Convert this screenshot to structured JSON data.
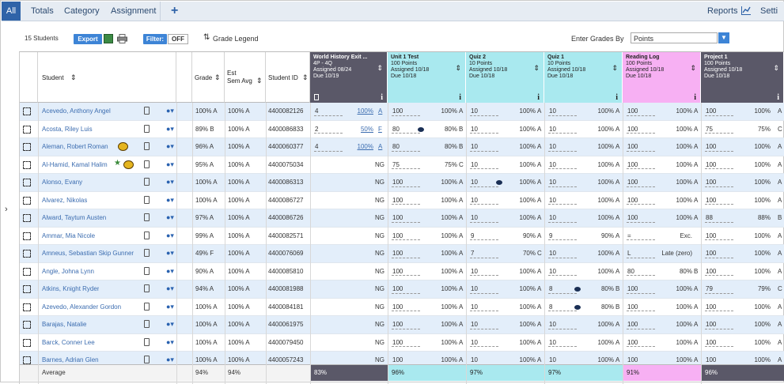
{
  "topbar": {
    "tabs": [
      "All",
      "Totals",
      "Category",
      "Assignment"
    ],
    "add_icon": "+",
    "reports_label": "Reports",
    "settings_label": "Setti"
  },
  "toolbar": {
    "student_count": "15 Students",
    "export_label": "Export",
    "filter_label": "Filter:",
    "filter_state": "OFF",
    "grade_legend": "Grade Legend",
    "enter_grades_label": "Enter Grades By",
    "enter_grades_value": "Points"
  },
  "columns": {
    "student": "Student",
    "grade": "Grade",
    "est_sem_avg_1": "Est",
    "est_sem_avg_2": "Sem Avg",
    "student_id": "Student ID"
  },
  "assignments": [
    {
      "title": "World History Exit ...",
      "l2": "4P - 4Q",
      "l3": "Assigned 08/24",
      "l4": "Due 10/19",
      "color": "#5a5868",
      "text": "#fff"
    },
    {
      "title": "Unit 1 Test",
      "l2": "100 Points",
      "l3": "Assigned 10/18",
      "l4": "Due 10/18",
      "color": "#a9e9ef",
      "text": "#222"
    },
    {
      "title": "Quiz 2",
      "l2": "10 Points",
      "l3": "Assigned 10/18",
      "l4": "Due 10/18",
      "color": "#a9e9ef",
      "text": "#222"
    },
    {
      "title": "Quiz 1",
      "l2": "10 Points",
      "l3": "Assigned 10/18",
      "l4": "Due 10/18",
      "color": "#a9e9ef",
      "text": "#222"
    },
    {
      "title": "Reading Log",
      "l2": "100 Points",
      "l3": "Assigned 10/18",
      "l4": "Due 10/18",
      "color": "#f7b0f3",
      "text": "#222"
    },
    {
      "title": "Project 1",
      "l2": "100 Points",
      "l3": "Assigned 10/18",
      "l4": "Due 10/18",
      "color": "#5a5868",
      "text": "#fff"
    }
  ],
  "students": [
    {
      "name": "Acevedo, Anthony Angel",
      "grade": "100% A",
      "est": "100% A",
      "id": "4400082126",
      "a1": [
        "4",
        "100%",
        "A"
      ],
      "a2": [
        "100",
        "100%",
        "A"
      ],
      "a3": [
        "10",
        "100%",
        "A"
      ],
      "a4": [
        "10",
        "100%",
        "A"
      ],
      "a5": [
        "100",
        "100%",
        "A"
      ],
      "a6": [
        "100",
        "100%",
        "A"
      ]
    },
    {
      "name": "Acosta, Riley Luis",
      "grade": "89% B",
      "est": "100% A",
      "id": "4400086833",
      "a1": [
        "2",
        "50%",
        "F"
      ],
      "a2": [
        "80",
        "80%",
        "B"
      ],
      "a3": [
        "10",
        "100%",
        "A"
      ],
      "a4": [
        "10",
        "100%",
        "A"
      ],
      "a5": [
        "100",
        "100%",
        "A"
      ],
      "a6": [
        "75",
        "75%",
        "C"
      ]
    },
    {
      "name": "Aleman, Robert Roman",
      "grade": "96% A",
      "est": "100% A",
      "id": "4400060377",
      "a1": [
        "4",
        "100%",
        "A"
      ],
      "a2": [
        "80",
        "80%",
        "B"
      ],
      "a3": [
        "10",
        "100%",
        "A"
      ],
      "a4": [
        "10",
        "100%",
        "A"
      ],
      "a5": [
        "100",
        "100%",
        "A"
      ],
      "a6": [
        "100",
        "100%",
        "A"
      ]
    },
    {
      "name": "Al-Hamid, Kamal Halim",
      "grade": "95% A",
      "est": "100% A",
      "id": "4400075034",
      "a1": [
        "",
        "",
        "NG"
      ],
      "a2": [
        "75",
        "75%",
        "C"
      ],
      "a3": [
        "10",
        "100%",
        "A"
      ],
      "a4": [
        "10",
        "100%",
        "A"
      ],
      "a5": [
        "100",
        "100%",
        "A"
      ],
      "a6": [
        "100",
        "100%",
        "A"
      ]
    },
    {
      "name": "Alonso, Evany",
      "grade": "100% A",
      "est": "100% A",
      "id": "4400086313",
      "a1": [
        "",
        "",
        "NG"
      ],
      "a2": [
        "100",
        "100%",
        "A"
      ],
      "a3": [
        "10",
        "100%",
        "A"
      ],
      "a4": [
        "10",
        "100%",
        "A"
      ],
      "a5": [
        "100",
        "100%",
        "A"
      ],
      "a6": [
        "100",
        "100%",
        "A"
      ]
    },
    {
      "name": "Alvarez, Nikolas",
      "grade": "100% A",
      "est": "100% A",
      "id": "4400086727",
      "a1": [
        "",
        "",
        "NG"
      ],
      "a2": [
        "100",
        "100%",
        "A"
      ],
      "a3": [
        "10",
        "100%",
        "A"
      ],
      "a4": [
        "10",
        "100%",
        "A"
      ],
      "a5": [
        "100",
        "100%",
        "A"
      ],
      "a6": [
        "100",
        "100%",
        "A"
      ]
    },
    {
      "name": "Alward, Taytum Austen",
      "grade": "97% A",
      "est": "100% A",
      "id": "4400086726",
      "a1": [
        "",
        "",
        "NG"
      ],
      "a2": [
        "100",
        "100%",
        "A"
      ],
      "a3": [
        "10",
        "100%",
        "A"
      ],
      "a4": [
        "10",
        "100%",
        "A"
      ],
      "a5": [
        "100",
        "100%",
        "A"
      ],
      "a6": [
        "88",
        "88%",
        "B"
      ]
    },
    {
      "name": "Ammar, Mia Nicole",
      "grade": "99% A",
      "est": "100% A",
      "id": "4400082571",
      "a1": [
        "",
        "",
        "NG"
      ],
      "a2": [
        "100",
        "100%",
        "A"
      ],
      "a3": [
        "9",
        "90%",
        "A"
      ],
      "a4": [
        "9",
        "90%",
        "A"
      ],
      "a5": [
        "=",
        "Exc.",
        ""
      ],
      "a6": [
        "100",
        "100%",
        "A"
      ]
    },
    {
      "name": "Amneus, Sebastian Skip Gunner",
      "grade": "49% F",
      "est": "100% A",
      "id": "4400076069",
      "a1": [
        "",
        "",
        "NG"
      ],
      "a2": [
        "100",
        "100%",
        "A"
      ],
      "a3": [
        "7",
        "70%",
        "C"
      ],
      "a4": [
        "10",
        "100%",
        "A"
      ],
      "a5": [
        "L",
        "Late (zero)",
        ""
      ],
      "a6": [
        "100",
        "100%",
        "A"
      ]
    },
    {
      "name": "Angle, Johna Lynn",
      "grade": "90% A",
      "est": "100% A",
      "id": "4400085810",
      "a1": [
        "",
        "",
        "NG"
      ],
      "a2": [
        "100",
        "100%",
        "A"
      ],
      "a3": [
        "10",
        "100%",
        "A"
      ],
      "a4": [
        "10",
        "100%",
        "A"
      ],
      "a5": [
        "80",
        "80%",
        "B"
      ],
      "a6": [
        "100",
        "100%",
        "A"
      ]
    },
    {
      "name": "Atkins, Knight Ryder",
      "grade": "94% A",
      "est": "100% A",
      "id": "4400081988",
      "a1": [
        "",
        "",
        "NG"
      ],
      "a2": [
        "100",
        "100%",
        "A"
      ],
      "a3": [
        "10",
        "100%",
        "A"
      ],
      "a4": [
        "8",
        "80%",
        "B"
      ],
      "a5": [
        "100",
        "100%",
        "A"
      ],
      "a6": [
        "79",
        "79%",
        "C"
      ]
    },
    {
      "name": "Azevedo, Alexander Gordon",
      "grade": "100% A",
      "est": "100% A",
      "id": "4400084181",
      "a1": [
        "",
        "",
        "NG"
      ],
      "a2": [
        "100",
        "100%",
        "A"
      ],
      "a3": [
        "10",
        "100%",
        "A"
      ],
      "a4": [
        "8",
        "80%",
        "B"
      ],
      "a5": [
        "100",
        "100%",
        "A"
      ],
      "a6": [
        "100",
        "100%",
        "A"
      ]
    },
    {
      "name": "Barajas, Natalie",
      "grade": "100% A",
      "est": "100% A",
      "id": "4400061975",
      "a1": [
        "",
        "",
        "NG"
      ],
      "a2": [
        "100",
        "100%",
        "A"
      ],
      "a3": [
        "10",
        "100%",
        "A"
      ],
      "a4": [
        "10",
        "100%",
        "A"
      ],
      "a5": [
        "100",
        "100%",
        "A"
      ],
      "a6": [
        "100",
        "100%",
        "A"
      ]
    },
    {
      "name": "Barck, Conner Lee",
      "grade": "100% A",
      "est": "100% A",
      "id": "4400079450",
      "a1": [
        "",
        "",
        "NG"
      ],
      "a2": [
        "100",
        "100%",
        "A"
      ],
      "a3": [
        "10",
        "100%",
        "A"
      ],
      "a4": [
        "10",
        "100%",
        "A"
      ],
      "a5": [
        "100",
        "100%",
        "A"
      ],
      "a6": [
        "100",
        "100%",
        "A"
      ]
    },
    {
      "name": "Barnes, Adrian Glen",
      "grade": "100% A",
      "est": "100% A",
      "id": "4400057243",
      "a1": [
        "",
        "",
        "NG"
      ],
      "a2": [
        "100",
        "100%",
        "A"
      ],
      "a3": [
        "10",
        "100%",
        "A"
      ],
      "a4": [
        "10",
        "100%",
        "A"
      ],
      "a5": [
        "100",
        "100%",
        "A"
      ],
      "a6": [
        "100",
        "100%",
        "A"
      ]
    }
  ],
  "average": {
    "label": "Average",
    "grade": "94%",
    "est": "94%",
    "assignments": [
      "83%",
      "96%",
      "97%",
      "97%",
      "91%",
      "96%"
    ]
  }
}
